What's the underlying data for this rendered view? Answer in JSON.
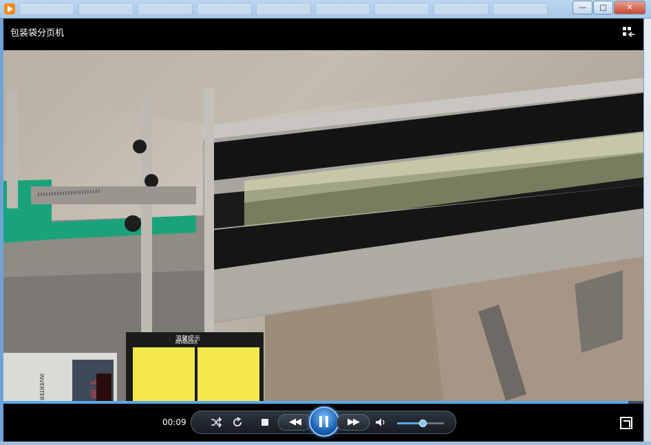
{
  "window": {
    "buttons": {
      "minimize": "—",
      "maximize": "□",
      "close": "✕"
    }
  },
  "player": {
    "title": "包装袋分页机",
    "current_time": "00:09",
    "progress_fraction": 0.976,
    "volume_fraction": 0.55
  },
  "icons": {
    "app": "media-player-icon",
    "layout": "layout-switch-icon",
    "shuffle": "shuffle-icon",
    "repeat": "repeat-icon",
    "stop": "stop-icon",
    "rewind": "rewind-icon",
    "pause": "pause-icon",
    "forward": "fast-forward-icon",
    "volume": "volume-icon",
    "fullscreen": "fullscreen-icon"
  },
  "video_overlay_text": {
    "reminder_title": "温馨提示",
    "reminder_subtitle": "REMINDER",
    "inverter_label": "INVERTER",
    "display_value": "5.00"
  },
  "colors": {
    "accent": "#5aa9ec",
    "belt": "#141414",
    "frame": "#9a9690",
    "green_bracket": "#1aa37a",
    "warning_yellow": "#f4e84a"
  }
}
